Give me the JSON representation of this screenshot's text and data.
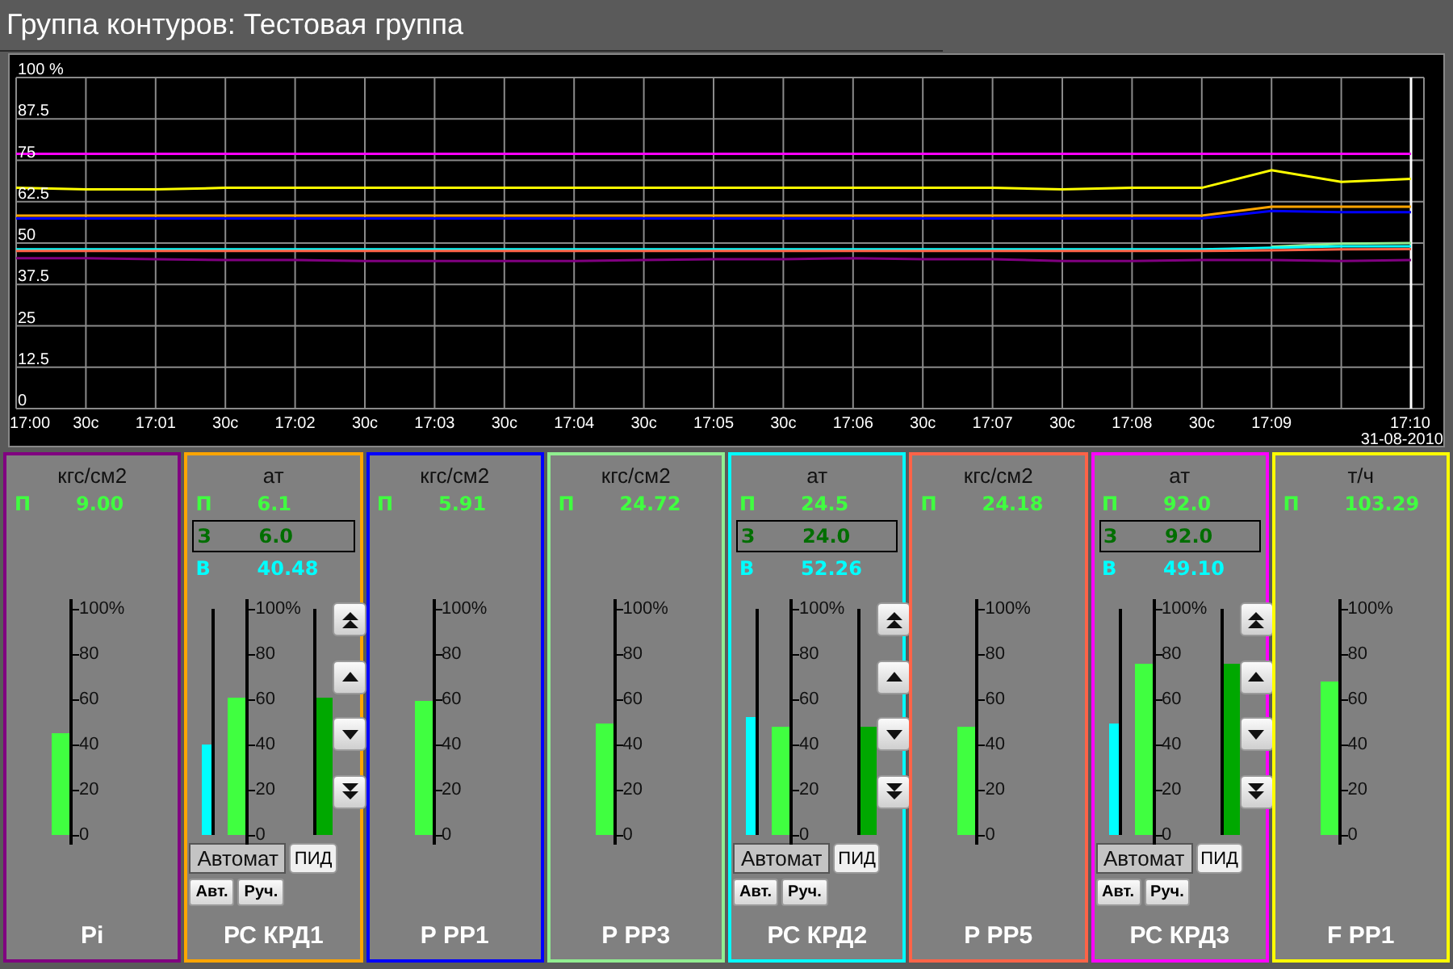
{
  "window": {
    "title": "Группа контуров: Тестовая группа"
  },
  "trend": {
    "chart_data": {
      "type": "line",
      "x": [
        "17:00",
        "30с",
        "17:01",
        "30с",
        "17:02",
        "30с",
        "17:03",
        "30с",
        "17:04",
        "30с",
        "17:05",
        "30с",
        "17:06",
        "30с",
        "17:07",
        "30с",
        "17:08",
        "30с",
        "17:09",
        null,
        "17:10"
      ],
      "grid": true,
      "ref_lines": [
        {
          "axis": "x",
          "value": "17:10",
          "color": "#ffffff"
        }
      ],
      "ylim": [
        0,
        100
      ],
      "yticks": [
        0,
        12.5,
        25,
        37.5,
        50,
        62.5,
        75,
        87.5,
        {
          "value": 100,
          "label": "100 %"
        }
      ],
      "series": [
        {
          "color": "#ff00ff",
          "values": [
            77,
            77,
            77,
            77,
            77,
            77,
            77,
            77,
            77,
            77,
            77,
            77,
            77,
            77,
            77,
            77,
            77,
            77,
            77,
            77,
            77
          ]
        },
        {
          "color": "#ffff00",
          "values": [
            66.7,
            66.2,
            66.2,
            66.7,
            66.7,
            66.7,
            66.7,
            66.7,
            66.7,
            66.7,
            66.7,
            66.7,
            66.7,
            66.7,
            66.7,
            66.2,
            66.7,
            66.7,
            72.0,
            68.5,
            69.4
          ]
        },
        {
          "color": "#ffa500",
          "values": [
            58.3,
            58.3,
            58.3,
            58.3,
            58.3,
            58.3,
            58.3,
            58.3,
            58.3,
            58.3,
            58.3,
            58.3,
            58.3,
            58.3,
            58.3,
            58.3,
            58.3,
            58.3,
            61,
            61,
            61
          ]
        },
        {
          "color": "#0000ff",
          "values": [
            57.4,
            57.4,
            57.4,
            57.4,
            57.4,
            57.4,
            57.4,
            57.4,
            57.4,
            57.4,
            57.4,
            57.4,
            57.4,
            57.4,
            57.4,
            57.4,
            57.4,
            57.4,
            59.7,
            59.3,
            59.3
          ]
        },
        {
          "color": "#90ee90",
          "values": [
            null,
            null,
            null,
            null,
            null,
            null,
            null,
            null,
            null,
            null,
            null,
            null,
            null,
            null,
            null,
            null,
            null,
            null,
            48.9,
            49.8,
            50
          ]
        },
        {
          "color": "#00ffff",
          "values": [
            48.1,
            48.1,
            48.1,
            48.1,
            48.1,
            48.1,
            48.1,
            48.1,
            48.1,
            48.1,
            48.1,
            48.1,
            48.1,
            48.1,
            48.1,
            48.1,
            48.1,
            48.1,
            48.6,
            49,
            49
          ]
        },
        {
          "color": "#ff6347",
          "values": [
            47.6,
            47.6,
            47.6,
            47.6,
            47.6,
            47.6,
            47.6,
            47.6,
            47.6,
            47.6,
            47.6,
            47.6,
            47.6,
            47.6,
            47.6,
            47.6,
            47.6,
            47.6,
            47.8,
            48.1,
            48.2
          ]
        },
        {
          "color": "#800080",
          "values": [
            45.4,
            45.4,
            45.1,
            44.9,
            44.9,
            44.6,
            44.6,
            44.6,
            44.6,
            44.9,
            45.1,
            45.1,
            45.4,
            45.1,
            45.1,
            44.6,
            44.6,
            44.9,
            44.9,
            44.6,
            44.9
          ]
        }
      ]
    },
    "date": "31-08-2010"
  },
  "panels": [
    {
      "kind": "meter",
      "color": "#800080",
      "unit": "кгс/см2",
      "readings": [
        {
          "kind": "pv",
          "label": "П",
          "value": "9.00"
        }
      ],
      "bars": [
        {
          "kind": "pv",
          "level": 0.45
        }
      ],
      "scale": [
        "100%",
        "80",
        "60",
        "40",
        "20",
        "0"
      ],
      "name": "Pi"
    },
    {
      "kind": "controller",
      "color": "#ffa500",
      "unit": "ат",
      "readings": [
        {
          "kind": "pv",
          "label": "П",
          "value": "6.1"
        },
        {
          "kind": "sp",
          "label": "З",
          "value": "6.0"
        },
        {
          "kind": "out",
          "label": "В",
          "value": "40.48"
        }
      ],
      "bars": [
        {
          "kind": "out",
          "level": 0.4
        },
        {
          "kind": "pv",
          "level": 0.61
        },
        {
          "kind": "sp",
          "level": 0.61
        }
      ],
      "scale": [
        "100%",
        "80",
        "60",
        "40",
        "20",
        "0"
      ],
      "mode": "Автомат",
      "pid": "ПИД",
      "buttons": [
        "Авт.",
        "Руч."
      ],
      "name": "РС КРД1"
    },
    {
      "kind": "meter",
      "color": "#0000ff",
      "unit": "кгс/см2",
      "readings": [
        {
          "kind": "pv",
          "label": "П",
          "value": "5.91"
        }
      ],
      "bars": [
        {
          "kind": "pv",
          "level": 0.59
        }
      ],
      "scale": [
        "100%",
        "80",
        "60",
        "40",
        "20",
        "0"
      ],
      "name": "Р РР1"
    },
    {
      "kind": "meter",
      "color": "#90ee90",
      "unit": "кгс/см2",
      "readings": [
        {
          "kind": "pv",
          "label": "П",
          "value": "24.72"
        }
      ],
      "bars": [
        {
          "kind": "pv",
          "level": 0.49
        }
      ],
      "scale": [
        "100%",
        "80",
        "60",
        "40",
        "20",
        "0"
      ],
      "name": "Р РР3"
    },
    {
      "kind": "controller",
      "color": "#00ffff",
      "unit": "ат",
      "readings": [
        {
          "kind": "pv",
          "label": "П",
          "value": "24.5"
        },
        {
          "kind": "sp",
          "label": "З",
          "value": "24.0"
        },
        {
          "kind": "out",
          "label": "В",
          "value": "52.26"
        }
      ],
      "bars": [
        {
          "kind": "out",
          "level": 0.52
        },
        {
          "kind": "pv",
          "level": 0.48
        },
        {
          "kind": "sp",
          "level": 0.48
        }
      ],
      "scale": [
        "100%",
        "80",
        "60",
        "40",
        "20",
        "0"
      ],
      "mode": "Автомат",
      "pid": "ПИД",
      "buttons": [
        "Авт.",
        "Руч."
      ],
      "name": "РС КРД2"
    },
    {
      "kind": "meter",
      "color": "#ff6347",
      "unit": "кгс/см2",
      "readings": [
        {
          "kind": "pv",
          "label": "П",
          "value": "24.18"
        }
      ],
      "bars": [
        {
          "kind": "pv",
          "level": 0.48
        }
      ],
      "scale": [
        "100%",
        "80",
        "60",
        "40",
        "20",
        "0"
      ],
      "name": "Р РР5"
    },
    {
      "kind": "controller",
      "color": "#ff00ff",
      "unit": "ат",
      "readings": [
        {
          "kind": "pv",
          "label": "П",
          "value": "92.0"
        },
        {
          "kind": "sp",
          "label": "З",
          "value": "92.0"
        },
        {
          "kind": "out",
          "label": "В",
          "value": "49.10"
        }
      ],
      "bars": [
        {
          "kind": "out",
          "level": 0.49
        },
        {
          "kind": "pv",
          "level": 0.76
        },
        {
          "kind": "sp",
          "level": 0.76
        }
      ],
      "scale": [
        "100%",
        "80",
        "60",
        "40",
        "20",
        "0"
      ],
      "mode": "Автомат",
      "pid": "ПИД",
      "buttons": [
        "Авт.",
        "Руч."
      ],
      "name": "РС КРД3"
    },
    {
      "kind": "meter",
      "color": "#ffff00",
      "unit": "т/ч",
      "readings": [
        {
          "kind": "pv",
          "label": "П",
          "value": "103.29"
        }
      ],
      "bars": [
        {
          "kind": "pv",
          "level": 0.68
        }
      ],
      "scale": [
        "100%",
        "80",
        "60",
        "40",
        "20",
        "0"
      ],
      "name": "F РР1"
    }
  ]
}
